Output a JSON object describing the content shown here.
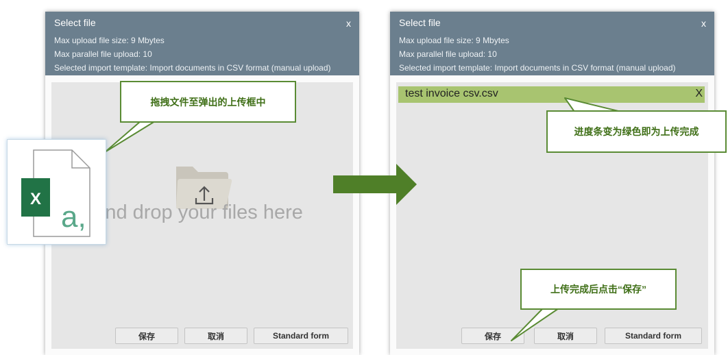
{
  "left_dialog": {
    "title": "Select file",
    "close": "x",
    "max_size": "Max upload file size: 9 Mbytes",
    "max_parallel": "Max parallel file upload: 10",
    "template": "Selected import template: Import documents in CSV format (manual upload)",
    "drop_text": "g and drop your files here",
    "buttons": {
      "save": "保存",
      "cancel": "取消",
      "standard": "Standard form"
    }
  },
  "right_dialog": {
    "title": "Select file",
    "close": "x",
    "max_size": "Max upload file size: 9 Mbytes",
    "max_parallel": "Max parallel file upload: 10",
    "template": "Selected import template: Import documents in CSV format (manual upload)",
    "file": {
      "name": "test invoice csv.csv",
      "remove": "X",
      "progress": 1.0
    },
    "buttons": {
      "save": "保存",
      "cancel": "取消",
      "standard": "Standard form"
    }
  },
  "callouts": {
    "drag": "拖拽文件至弹出的上传框中",
    "progress": "进度条变为绿色即为上传完成",
    "save": "上传完成后点击“保存”"
  },
  "excel_icon": {
    "letter": "X",
    "suffix": "a,"
  },
  "colors": {
    "header": "#6b7f8e",
    "drop_area": "#e6e6e6",
    "progress_green": "#a8c470",
    "callout_border": "#5a8b34",
    "callout_text": "#3f6f17",
    "arrow": "#4f7f28",
    "excel_green": "#217346"
  },
  "icons": [
    "folder-upload-icon",
    "excel-file-icon",
    "right-arrow-icon"
  ]
}
